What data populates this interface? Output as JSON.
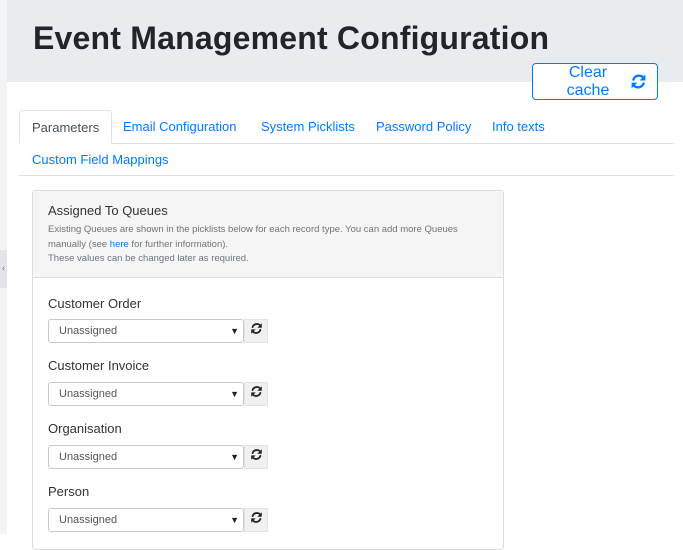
{
  "header": {
    "title": "Event Management Configuration",
    "clear_cache_label": "Clear cache"
  },
  "tabs": [
    {
      "label": "Parameters",
      "active": true
    },
    {
      "label": "Email Configuration",
      "active": false
    },
    {
      "label": "System Picklists",
      "active": false
    },
    {
      "label": "Password Policy",
      "active": false
    },
    {
      "label": "Info texts",
      "active": false
    },
    {
      "label": "Custom Field Mappings",
      "active": false
    }
  ],
  "queues_card": {
    "title": "Assigned To Queues",
    "desc_part1": "Existing Queues are shown in the picklists below for each record type. You can add more Queues manually (see ",
    "desc_link": "here",
    "desc_part2": " for further information).",
    "desc_line2": "These values can be changed later as required.",
    "fields": [
      {
        "label": "Customer Order",
        "value": "Unassigned"
      },
      {
        "label": "Customer Invoice",
        "value": "Unassigned"
      },
      {
        "label": "Organisation",
        "value": "Unassigned"
      },
      {
        "label": "Person",
        "value": "Unassigned"
      }
    ]
  },
  "icons": {
    "refresh": "refresh-icon",
    "dropdown": "caret-down-icon",
    "collapse": "chevron-left-icon"
  },
  "colors": {
    "accent": "#007bff",
    "header_bg": "#e9ecef",
    "card_header_bg": "#f5f5f5"
  }
}
